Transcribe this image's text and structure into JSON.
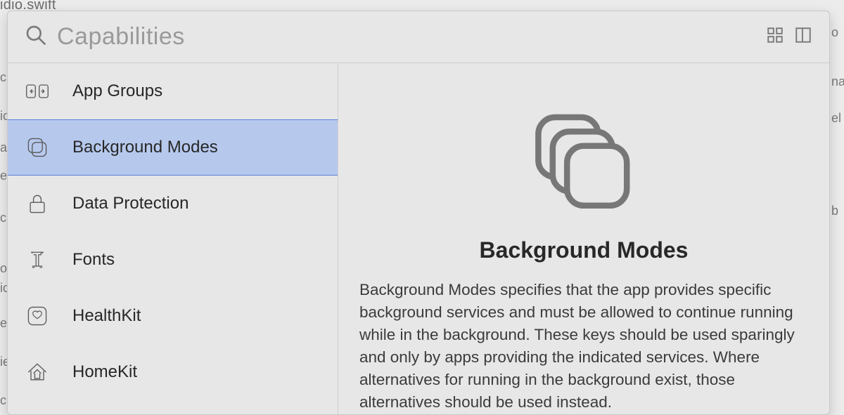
{
  "backdrop": {
    "filetab": "idio.swift",
    "right_fragments": [
      "o",
      "na",
      "el",
      "b"
    ],
    "left_fragments": [
      "c",
      "ic",
      "a",
      "e",
      "c",
      "oi",
      "ic",
      "e",
      "ie",
      "c"
    ]
  },
  "toolbar": {
    "search_placeholder": "Capabilities"
  },
  "sidebar": {
    "items": [
      {
        "icon": "app-groups-icon",
        "label": "App Groups",
        "selected": false
      },
      {
        "icon": "background-modes-icon",
        "label": "Background Modes",
        "selected": true
      },
      {
        "icon": "lock-icon",
        "label": "Data Protection",
        "selected": false
      },
      {
        "icon": "fonts-icon",
        "label": "Fonts",
        "selected": false
      },
      {
        "icon": "healthkit-icon",
        "label": "HealthKit",
        "selected": false
      },
      {
        "icon": "homekit-icon",
        "label": "HomeKit",
        "selected": false
      }
    ]
  },
  "detail": {
    "title": "Background Modes",
    "description": "Background Modes specifies that the app provides specific background services and must be allowed to continue running while in the background. These keys should be used sparingly and only by apps providing the indicated services. Where alternatives for running in the background exist, those alternatives should be used instead."
  }
}
